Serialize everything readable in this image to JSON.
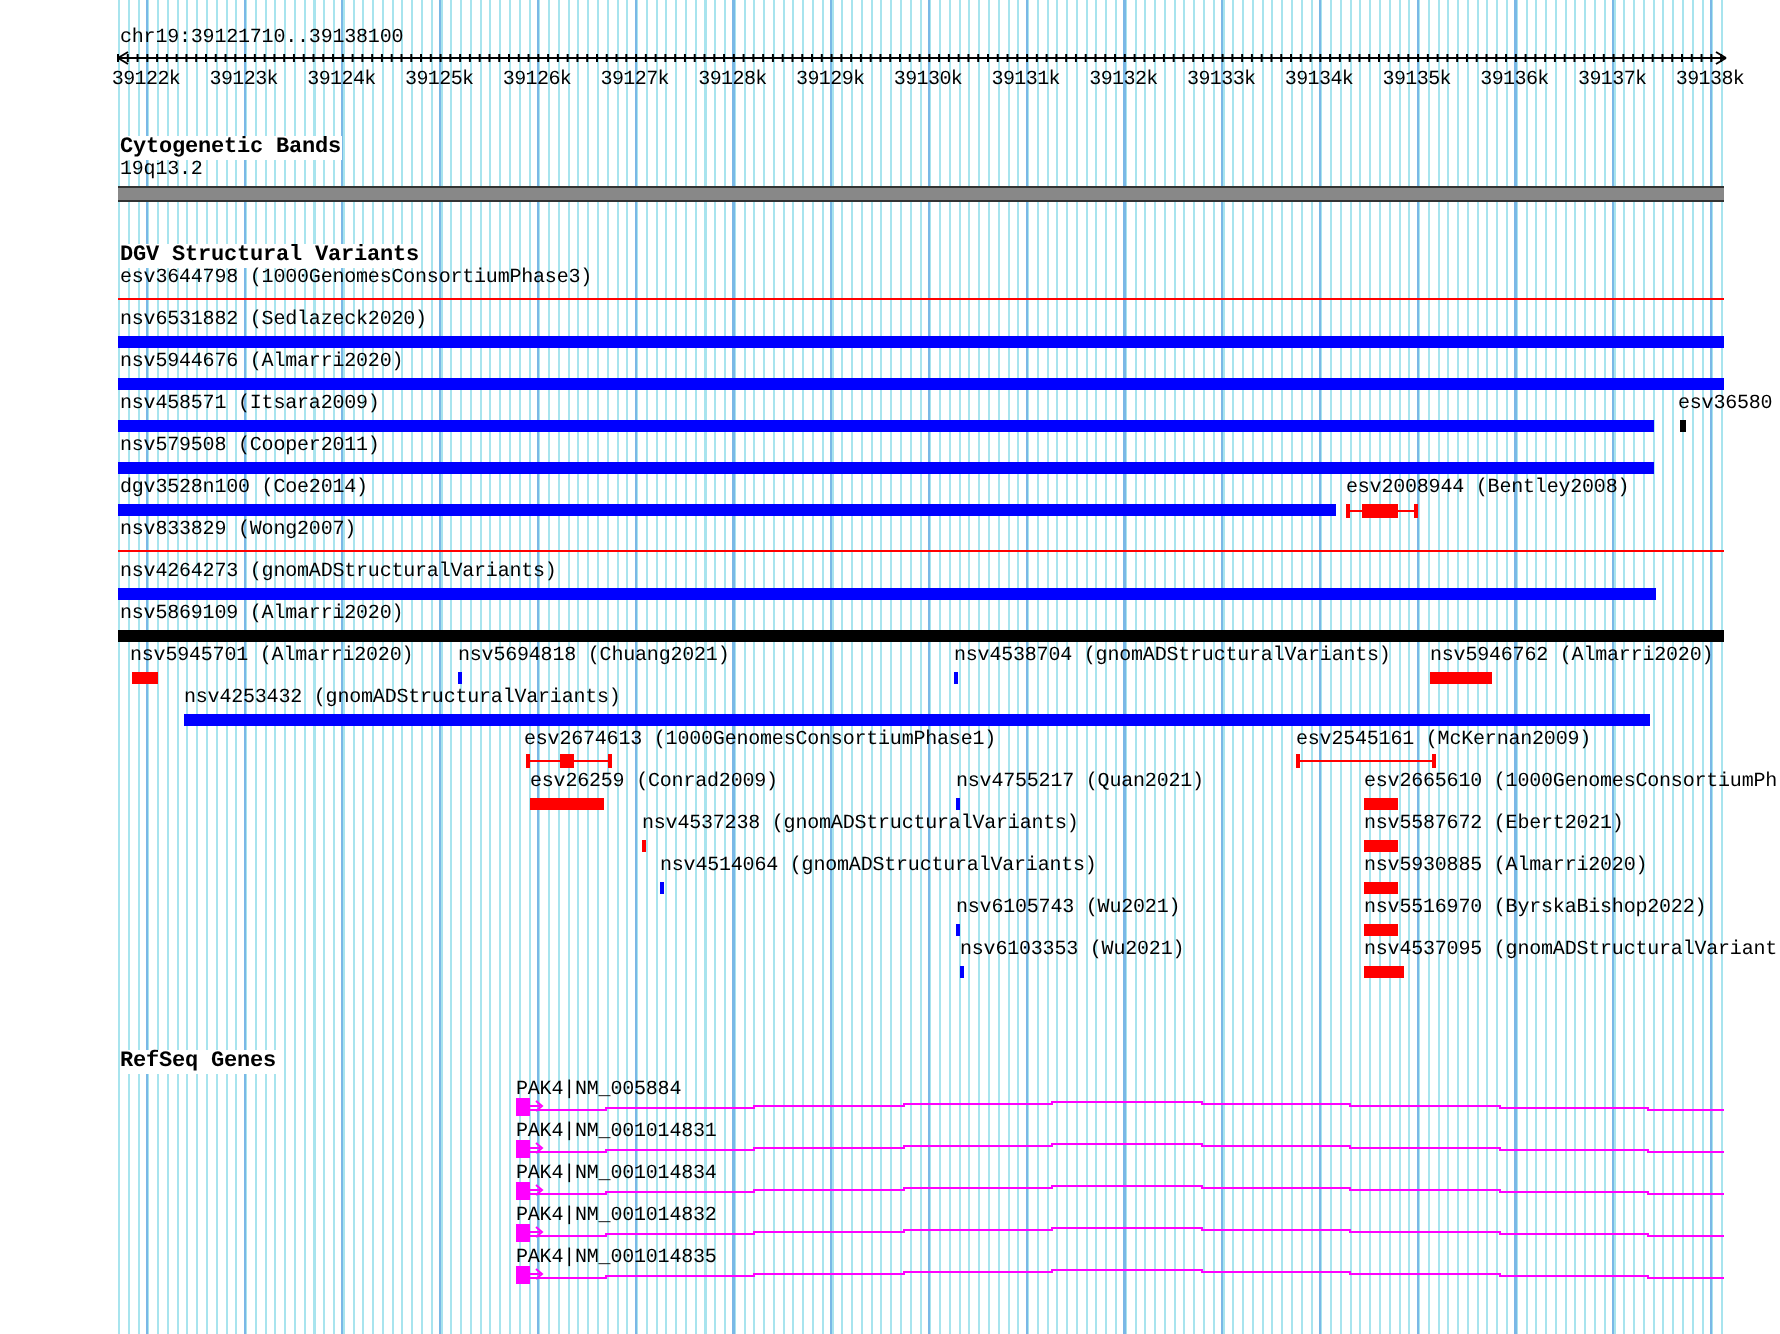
{
  "ruler": {
    "location": "chr19:39121710..39138100",
    "ticks": [
      "39122k",
      "39123k",
      "39124k",
      "39125k",
      "39126k",
      "39127k",
      "39128k",
      "39129k",
      "39130k",
      "39131k",
      "39132k",
      "39133k",
      "39134k",
      "39135k",
      "39136k",
      "39137k",
      "39138k"
    ]
  },
  "tracks": [
    {
      "title": "Cytogenetic Bands",
      "kind": "bands",
      "features": [
        {
          "label": "19q13.2"
        }
      ]
    },
    {
      "title": "DGV Structural Variants",
      "kind": "variants",
      "features": [
        {
          "label": "esv3644798 (1000GenomesConsortiumPhase3)",
          "kind": "line",
          "color": "#ff0000"
        },
        {
          "label": "nsv6531882 (Sedlazeck2020)",
          "kind": "bar",
          "color": "#0000ff"
        },
        {
          "label": "nsv5944676 (Almarri2020)",
          "kind": "bar",
          "color": "#0000ff"
        },
        {
          "label": "nsv458571 (Itsara2009)",
          "kind": "bar",
          "color": "#0000ff"
        },
        {
          "label": "esv36580",
          "kind": "bar",
          "color": "#000000"
        },
        {
          "label": "nsv579508 (Cooper2011)",
          "kind": "bar",
          "color": "#0000ff"
        },
        {
          "label": "dgv3528n100 (Coe2014)",
          "kind": "bar",
          "color": "#0000ff"
        },
        {
          "label": "esv2008944 (Bentley2008)",
          "kind": "whisker",
          "color": "#ff0000"
        },
        {
          "label": "nsv833829 (Wong2007)",
          "kind": "line",
          "color": "#ff0000"
        },
        {
          "label": "nsv4264273 (gnomADStructuralVariants)",
          "kind": "bar",
          "color": "#0000ff"
        },
        {
          "label": "nsv5869109 (Almarri2020)",
          "kind": "bar",
          "color": "#000000"
        },
        {
          "label": "nsv5945701 (Almarri2020)",
          "kind": "bar",
          "color": "#ff0000"
        },
        {
          "label": "nsv5694818 (Chuang2021)",
          "kind": "bar",
          "color": "#0000ff"
        },
        {
          "label": "nsv4538704 (gnomADStructuralVariants)",
          "kind": "bar",
          "color": "#0000ff"
        },
        {
          "label": "nsv5946762 (Almarri2020)",
          "kind": "bar",
          "color": "#ff0000"
        },
        {
          "label": "nsv4253432 (gnomADStructuralVariants)",
          "kind": "bar",
          "color": "#0000ff"
        },
        {
          "label": "esv2674613 (1000GenomesConsortiumPhase1)",
          "kind": "whisker",
          "color": "#ff0000"
        },
        {
          "label": "esv2545161 (McKernan2009)",
          "kind": "whisker",
          "color": "#ff0000"
        },
        {
          "label": "esv26259 (Conrad2009)",
          "kind": "bar",
          "color": "#ff0000"
        },
        {
          "label": "nsv4755217 (Quan2021)",
          "kind": "bar",
          "color": "#0000ff"
        },
        {
          "label": "esv2665610 (1000GenomesConsortiumPh",
          "kind": "bar",
          "color": "#ff0000"
        },
        {
          "label": "nsv4537238 (gnomADStructuralVariants)",
          "kind": "bar",
          "color": "#ff0000"
        },
        {
          "label": "nsv5587672 (Ebert2021)",
          "kind": "bar",
          "color": "#ff0000"
        },
        {
          "label": "nsv4514064 (gnomADStructuralVariants)",
          "kind": "bar",
          "color": "#0000ff"
        },
        {
          "label": "nsv5930885 (Almarri2020)",
          "kind": "bar",
          "color": "#ff0000"
        },
        {
          "label": "nsv6105743 (Wu2021)",
          "kind": "bar",
          "color": "#0000ff"
        },
        {
          "label": "nsv5516970 (ByrskaBishop2022)",
          "kind": "bar",
          "color": "#ff0000"
        },
        {
          "label": "nsv6103353 (Wu2021)",
          "kind": "bar",
          "color": "#0000ff"
        },
        {
          "label": "nsv4537095 (gnomADStructuralVariant",
          "kind": "bar",
          "color": "#ff0000"
        }
      ]
    },
    {
      "title": "RefSeq Genes",
      "kind": "genes",
      "features": [
        {
          "label": "PAK4|NM_005884"
        },
        {
          "label": "PAK4|NM_001014831"
        },
        {
          "label": "PAK4|NM_001014834"
        },
        {
          "label": "PAK4|NM_001014832"
        },
        {
          "label": "PAK4|NM_001014835"
        }
      ]
    }
  ]
}
